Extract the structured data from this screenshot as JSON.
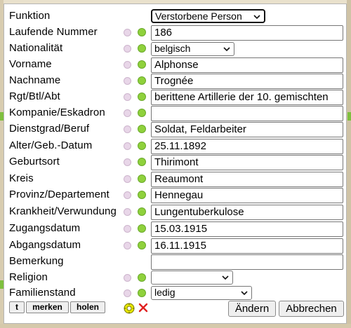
{
  "colors": {
    "field_border": "#767676",
    "dot_green": "#8fd13c",
    "dot_purple": "#e8d6e8",
    "delete_red": "#e02020",
    "button_bg": "#efefef"
  },
  "header": {
    "label": "Funktion",
    "selected": "Verstorbene Person"
  },
  "rows": [
    {
      "label": "Laufende Nummer",
      "value": "186"
    },
    {
      "label": "Nationalität",
      "value": "belgisch"
    },
    {
      "label": "Vorname",
      "value": "Alphonse"
    },
    {
      "label": "Nachname",
      "value": "Trognée"
    },
    {
      "label": "Rgt/Btl/Abt",
      "value": "berittene Artillerie der 10. gemischten"
    },
    {
      "label": "Kompanie/Eskadron",
      "value": ""
    },
    {
      "label": "Dienstgrad/Beruf",
      "value": "Soldat, Feldarbeiter"
    },
    {
      "label": "Alter/Geb.-Datum",
      "value": "25.11.1892"
    },
    {
      "label": "Geburtsort",
      "value": "Thirimont"
    },
    {
      "label": "Kreis",
      "value": "Reaumont"
    },
    {
      "label": "Provinz/Departement",
      "value": "Hennegau"
    },
    {
      "label": "Krankheit/Verwundung",
      "value": "Lungentuberkulose"
    },
    {
      "label": "Zugangsdatum",
      "value": "15.03.1915"
    },
    {
      "label": "Abgangsdatum",
      "value": "16.11.1915"
    },
    {
      "label": "Bemerkung",
      "value": ""
    },
    {
      "label": "Religion",
      "value": ""
    },
    {
      "label": "Familienstand",
      "value": "ledig"
    }
  ],
  "buttons": {
    "t": "t",
    "merken": "merken",
    "holen": "holen",
    "aendern": "Ändern",
    "abbrechen": "Abbrechen"
  },
  "icons": {
    "settings": "gear-icon",
    "delete": "close-icon"
  }
}
